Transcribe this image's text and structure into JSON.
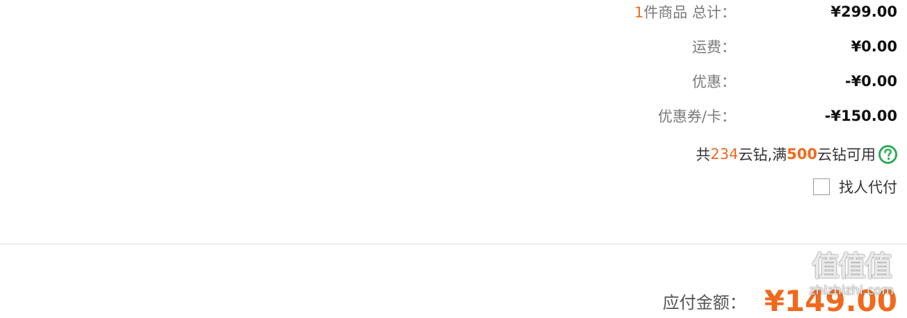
{
  "summary": {
    "items_count": "1",
    "items_label": "件商品 总计：",
    "items_total": "¥299.00",
    "shipping_label": "运费：",
    "shipping_value": "¥0.00",
    "discount_label": "优惠：",
    "discount_value": "-¥0.00",
    "coupon_label": "优惠券/卡：",
    "coupon_value": "-¥150.00"
  },
  "coins": {
    "prefix": "共 ",
    "count": "234",
    "middle": "云钻,满",
    "threshold": "500",
    "suffix": " 云钻可用",
    "help_icon": "question-circle-icon"
  },
  "pay_for_me": {
    "label": "找人代付",
    "checked": false
  },
  "total": {
    "label": "应付金额：",
    "amount": "¥149.00"
  },
  "watermark": {
    "logo": "值值值",
    "text": "zhizhizhi.com"
  },
  "colors": {
    "accent": "#f0691c",
    "help_icon": "#2eab5a",
    "divider": "#dddddd"
  }
}
